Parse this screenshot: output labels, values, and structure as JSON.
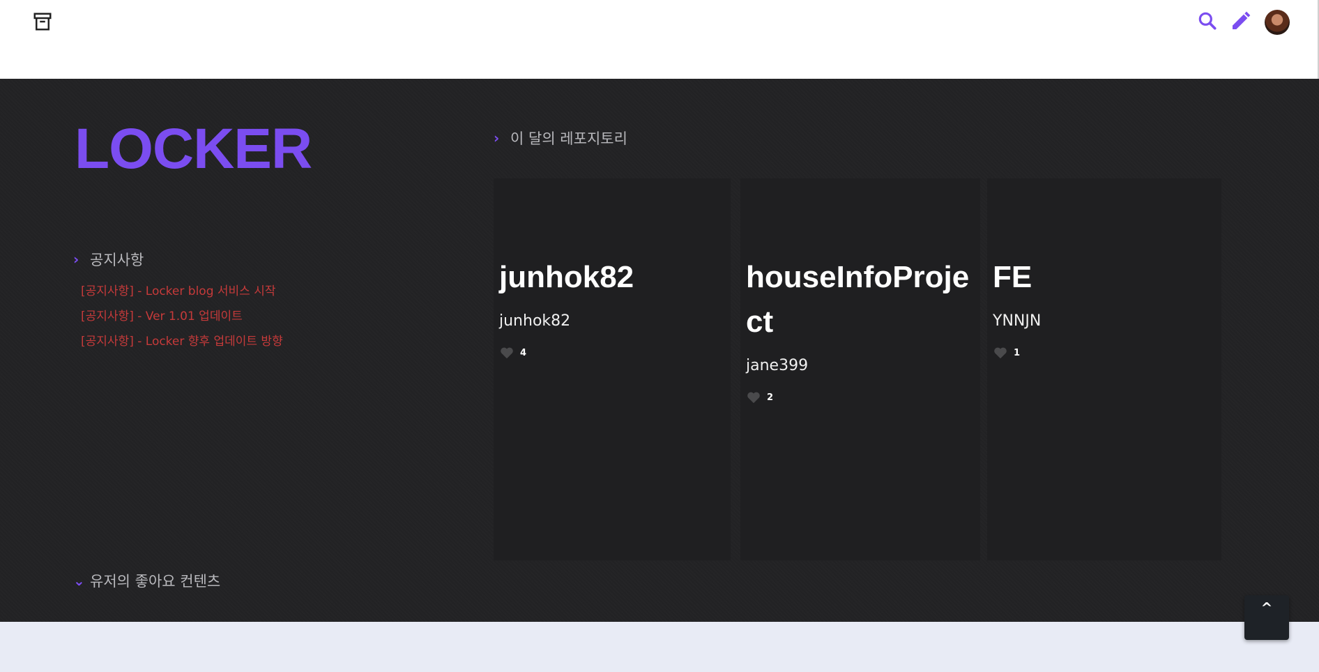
{
  "header": {
    "archive_icon": "archive-icon",
    "search_icon": "search-icon",
    "edit_icon": "pencil-icon",
    "avatar": "user-avatar",
    "accent_color": "#7b4df0"
  },
  "brand": {
    "logo": "LOCKER"
  },
  "notice": {
    "heading": "공지사항",
    "items": [
      "[공지사항] - Locker blog 서비스 시작",
      "[공지사항] - Ver 1.01 업데이트",
      "[공지사항] - Locker 향후 업데이트 방향"
    ],
    "item_color": "#c63a3a"
  },
  "repos": {
    "heading": "이 달의 레포지토리",
    "cards": [
      {
        "title": "junhok82",
        "owner": "junhok82",
        "likes": "4"
      },
      {
        "title": "houseInfoProject",
        "owner": "jane399",
        "likes": "2"
      },
      {
        "title": "FE",
        "owner": "YNNJN",
        "likes": "1"
      }
    ]
  },
  "liked": {
    "heading": "유저의 좋아요 컨텐츠"
  },
  "scroll_top": {
    "label": "^"
  }
}
